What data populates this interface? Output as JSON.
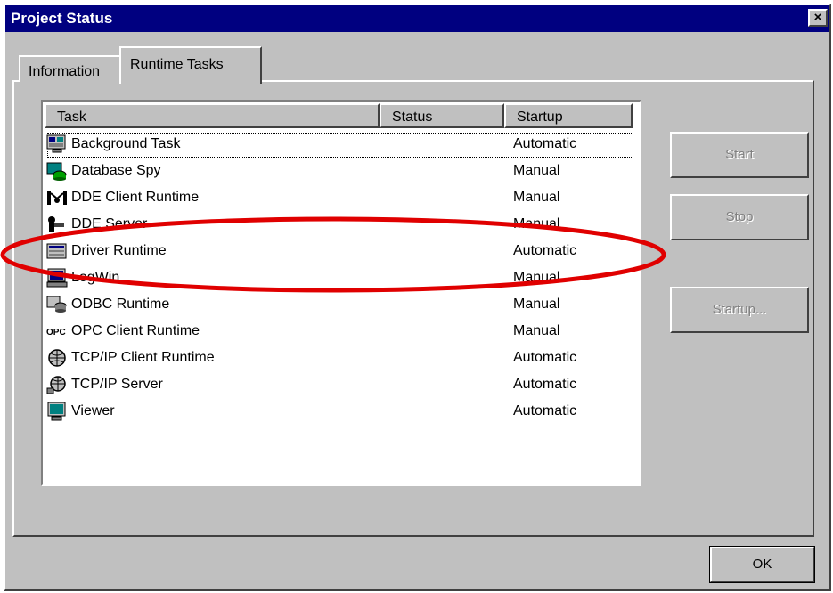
{
  "window": {
    "title": "Project Status",
    "close_label": "×"
  },
  "tabs": [
    {
      "label": "Information",
      "active": false
    },
    {
      "label": "Runtime Tasks",
      "active": true
    }
  ],
  "table": {
    "columns": [
      "Task",
      "Status",
      "Startup"
    ],
    "rows": [
      {
        "task": "Background Task",
        "status": "",
        "startup": "Automatic",
        "icon": "background-task-icon"
      },
      {
        "task": "Database Spy",
        "status": "",
        "startup": "Manual",
        "icon": "database-spy-icon"
      },
      {
        "task": "DDE Client Runtime",
        "status": "",
        "startup": "Manual",
        "icon": "dde-client-icon"
      },
      {
        "task": "DDE Server",
        "status": "",
        "startup": "Manual",
        "icon": "dde-server-icon"
      },
      {
        "task": "Driver Runtime",
        "status": "",
        "startup": "Automatic",
        "icon": "driver-runtime-icon"
      },
      {
        "task": "LogWin",
        "status": "",
        "startup": "Manual",
        "icon": "logwin-icon"
      },
      {
        "task": "ODBC Runtime",
        "status": "",
        "startup": "Manual",
        "icon": "odbc-runtime-icon"
      },
      {
        "task": "OPC Client Runtime",
        "status": "",
        "startup": "Manual",
        "icon": "opc-client-icon"
      },
      {
        "task": "TCP/IP Client Runtime",
        "status": "",
        "startup": "Automatic",
        "icon": "tcpip-client-icon"
      },
      {
        "task": "TCP/IP Server",
        "status": "",
        "startup": "Automatic",
        "icon": "tcpip-server-icon"
      },
      {
        "task": "Viewer",
        "status": "",
        "startup": "Automatic",
        "icon": "viewer-icon"
      }
    ]
  },
  "buttons": {
    "start": {
      "label": "Start",
      "enabled": false
    },
    "stop": {
      "label": "Stop",
      "enabled": false
    },
    "startup": {
      "label": "Startup...",
      "enabled": false
    },
    "ok": {
      "label": "OK",
      "enabled": true
    }
  },
  "colors": {
    "titlebar": "#000080",
    "face": "#c0c0c0",
    "annotation": "#e00000"
  },
  "annotation": {
    "highlighted_row": "Driver Runtime"
  }
}
